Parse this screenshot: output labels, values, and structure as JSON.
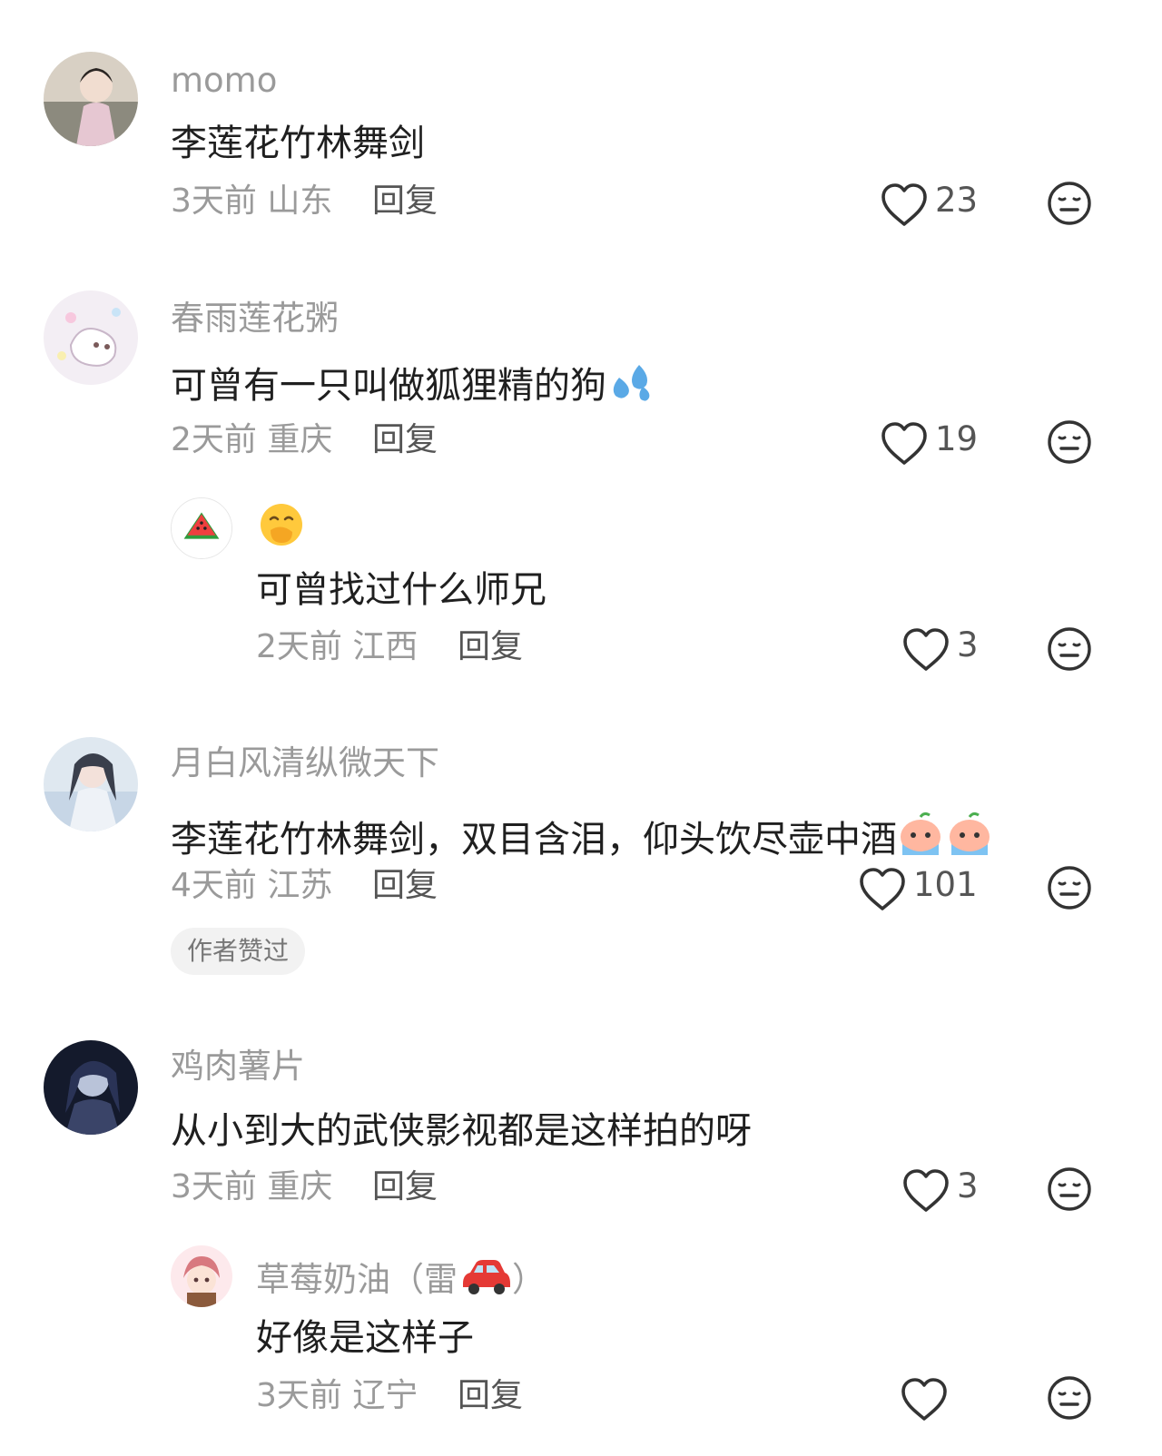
{
  "comments": [
    {
      "username": "momo",
      "text": "李莲花竹林舞剑",
      "time": "3天前",
      "location": "山东",
      "reply_label": "回复",
      "likes": "23"
    },
    {
      "username": "春雨莲花粥",
      "text": "可曾有一只叫做狐狸精的狗",
      "time": "2天前",
      "location": "重庆",
      "reply_label": "回复",
      "likes": "19",
      "replies": [
        {
          "username": "",
          "text": "可曾找过什么师兄",
          "time": "2天前",
          "location": "江西",
          "reply_label": "回复",
          "likes": "3"
        }
      ]
    },
    {
      "username": "月白风清纵微天下",
      "text": "李莲花竹林舞剑，双目含泪，仰头饮尽壶中酒",
      "time": "4天前",
      "location": "江苏",
      "reply_label": "回复",
      "likes": "101",
      "badge": "作者赞过"
    },
    {
      "username": "鸡肉薯片",
      "text": "从小到大的武侠影视都是这样拍的呀",
      "time": "3天前",
      "location": "重庆",
      "reply_label": "回复",
      "likes": "3",
      "replies": [
        {
          "username": "草莓奶油（雷",
          "username_end": "）",
          "text": "好像是这样子",
          "time": "3天前",
          "location": "辽宁",
          "reply_label": "回复",
          "likes": ""
        }
      ]
    }
  ],
  "icons": {
    "like": "heart-outline-icon",
    "dislike": "neutral-face-icon"
  },
  "colors": {
    "meta_gray": "#9a9a9a",
    "text": "#1f1f1f"
  }
}
